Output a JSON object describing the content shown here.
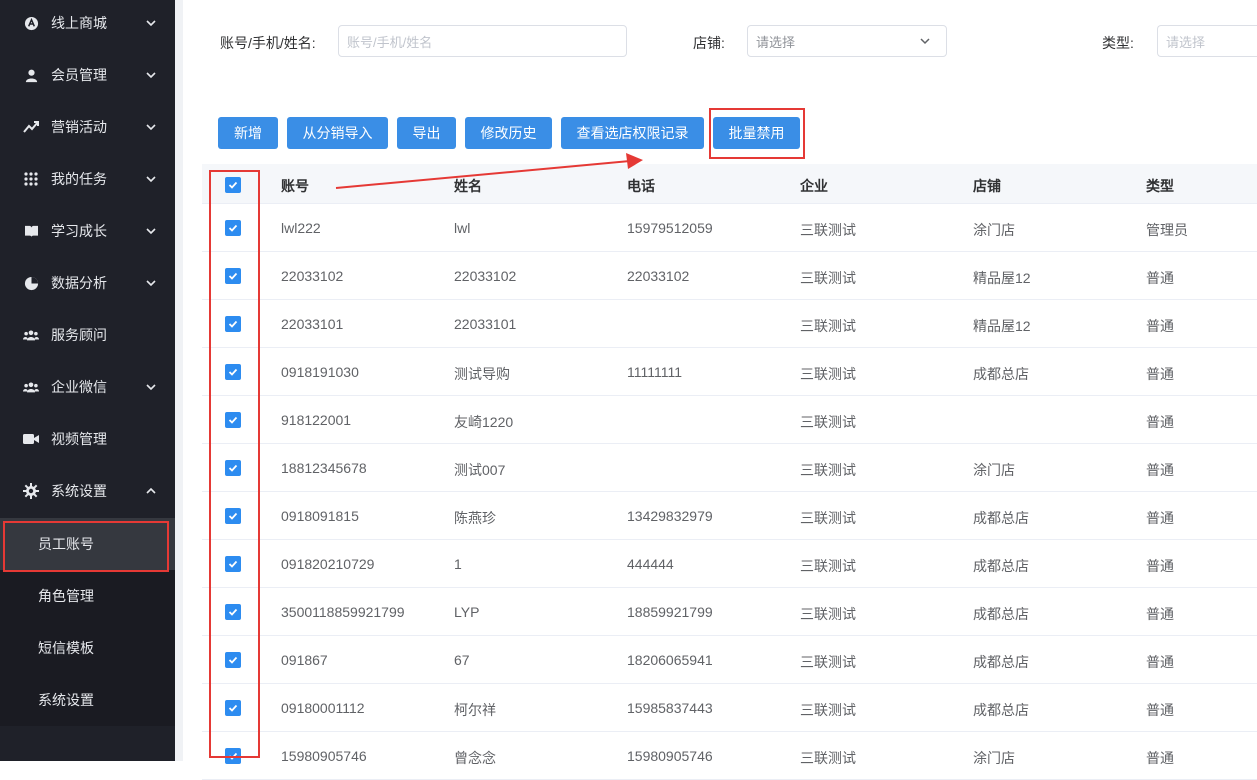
{
  "sidebar": {
    "items": [
      {
        "label": "线上商城",
        "icon": "storefront-icon",
        "expandable": true
      },
      {
        "label": "会员管理",
        "icon": "user-icon",
        "expandable": true
      },
      {
        "label": "营销活动",
        "icon": "trend-icon",
        "expandable": true
      },
      {
        "label": "我的任务",
        "icon": "grid-icon",
        "expandable": true
      },
      {
        "label": "学习成长",
        "icon": "book-icon",
        "expandable": true
      },
      {
        "label": "数据分析",
        "icon": "pie-chart-icon",
        "expandable": true
      },
      {
        "label": "服务顾问",
        "icon": "group-icon",
        "expandable": false
      },
      {
        "label": "企业微信",
        "icon": "group-icon",
        "expandable": true
      },
      {
        "label": "视频管理",
        "icon": "video-icon",
        "expandable": false
      },
      {
        "label": "系统设置",
        "icon": "gear-icon",
        "expandable": true,
        "expanded": true
      }
    ],
    "subitems": [
      {
        "label": "员工账号",
        "active": true
      },
      {
        "label": "角色管理",
        "active": false
      },
      {
        "label": "短信模板",
        "active": false
      },
      {
        "label": "系统设置",
        "active": false
      }
    ]
  },
  "filters": {
    "account_label": "账号/手机/姓名:",
    "account_placeholder": "账号/手机/姓名",
    "store_label": "店铺:",
    "store_placeholder": "请选择",
    "type_label": "类型:",
    "type_placeholder": "请选择"
  },
  "toolbar": {
    "add": "新增",
    "import": "从分销导入",
    "export": "导出",
    "history": "修改历史",
    "store_perm": "查看选店权限记录",
    "batch_disable": "批量禁用"
  },
  "table": {
    "headers": [
      "账号",
      "姓名",
      "电话",
      "企业",
      "店铺",
      "类型"
    ],
    "rows": [
      [
        "lwl222",
        "lwl",
        "15979512059",
        "三联测试",
        "涂门店",
        "管理员"
      ],
      [
        "22033102",
        "22033102",
        "22033102",
        "三联测试",
        "精品屋12",
        "普通"
      ],
      [
        "22033101",
        "22033101",
        "",
        "三联测试",
        "精品屋12",
        "普通"
      ],
      [
        "0918191030",
        "测试导购",
        "11111111",
        "三联测试",
        "成都总店",
        "普通"
      ],
      [
        "918122001",
        "友崎1220",
        "",
        "三联测试",
        "",
        "普通"
      ],
      [
        "18812345678",
        "测试007",
        "",
        "三联测试",
        "涂门店",
        "普通"
      ],
      [
        "0918091815",
        "陈燕珍",
        "13429832979",
        "三联测试",
        "成都总店",
        "普通"
      ],
      [
        "091820210729",
        "1",
        "444444",
        "三联测试",
        "成都总店",
        "普通"
      ],
      [
        "3500118859921799",
        "LYP",
        "18859921799",
        "三联测试",
        "成都总店",
        "普通"
      ],
      [
        "091867",
        "67",
        "18206065941",
        "三联测试",
        "成都总店",
        "普通"
      ],
      [
        "09180001112",
        "柯尔祥",
        "15985837443",
        "三联测试",
        "成都总店",
        "普通"
      ],
      [
        "15980905746",
        "曾念念",
        "15980905746",
        "三联测试",
        "涂门店",
        "普通"
      ]
    ]
  },
  "colors": {
    "sidebar_bg": "#1f2129",
    "primary": "#3a8ee6",
    "checkbox": "#2d8cf0",
    "annotation": "#e53935"
  }
}
